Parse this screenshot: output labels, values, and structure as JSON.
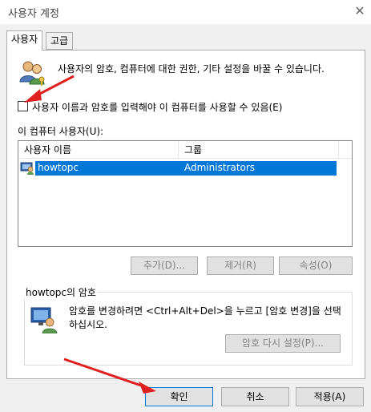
{
  "window": {
    "title": "사용자 계정"
  },
  "tabs": [
    {
      "label": "사용자"
    },
    {
      "label": "고급"
    }
  ],
  "users_tab": {
    "description": "사용자의 암호, 컴퓨터에 대한 권한, 기타 설정을 바꿀 수 있습니다.",
    "require_login_checkbox": {
      "label": "사용자 이름과 암호를 입력해야 이 컴퓨터를 사용할 수 있음(E)",
      "checked": false
    },
    "list_label": "이 컴퓨터 사용자(U):",
    "columns": [
      "사용자 이름",
      "그룹"
    ],
    "rows": [
      {
        "name": "howtopc",
        "group": "Administrators",
        "selected": true
      }
    ],
    "buttons": {
      "add": "추가(D)...",
      "remove": "제거(R)",
      "properties": "속성(O)"
    },
    "password_group": {
      "title": "howtopc의 암호",
      "text": "암호를 변경하려면 <Ctrl+Alt+Del>을 누르고 [암호 변경]을 선택하십시오.",
      "reset_button": "암호 다시 설정(P)..."
    }
  },
  "footer": {
    "ok": "확인",
    "cancel": "취소",
    "apply": "적용(A)"
  },
  "colors": {
    "selection": "#0078d7",
    "annotation_arrow": "#e02020"
  }
}
